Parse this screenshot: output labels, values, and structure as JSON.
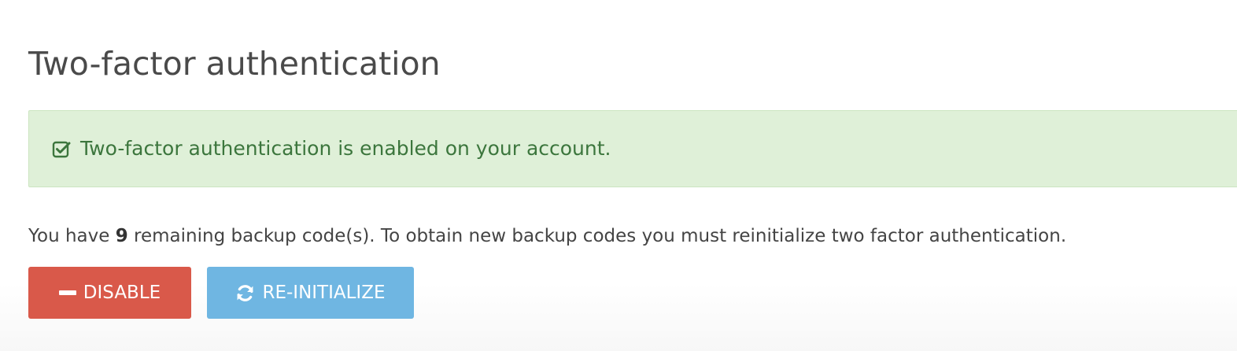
{
  "page": {
    "title": "Two-factor authentication"
  },
  "alert": {
    "icon": "check-square-icon",
    "message": "Two-factor authentication is enabled on your account.",
    "colors": {
      "background": "#dff0d8",
      "text": "#3c763d"
    }
  },
  "backup_info": {
    "prefix": "You have ",
    "count": "9",
    "suffix": " remaining backup code(s). To obtain new backup codes you must reinitialize two factor authentication."
  },
  "buttons": {
    "disable": {
      "label": "DISABLE",
      "icon": "minus-icon",
      "color": "#d9594a"
    },
    "reinitialize": {
      "label": "RE-INITIALIZE",
      "icon": "refresh-icon",
      "color": "#6fb6e2"
    }
  }
}
